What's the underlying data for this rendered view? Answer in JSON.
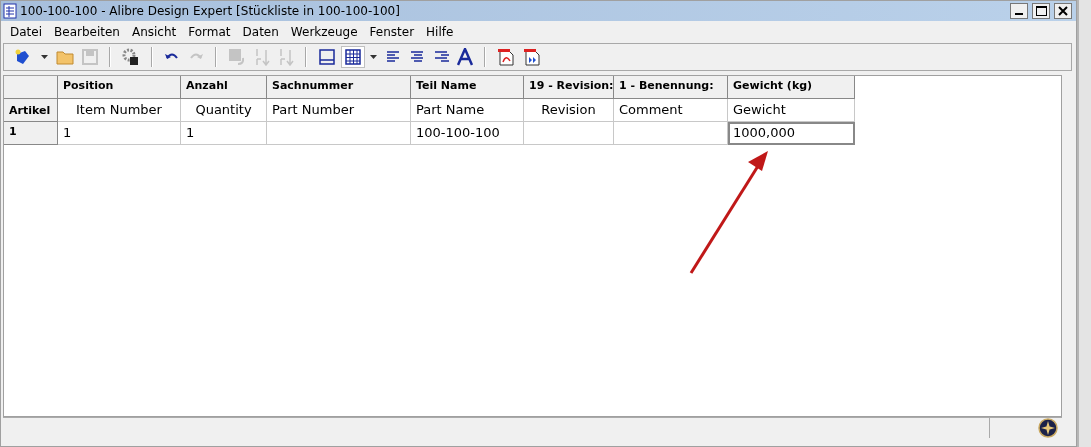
{
  "window": {
    "title": "100-100-100 - Alibre Design Expert [Stückliste in 100-100-100]"
  },
  "menu": [
    "Datei",
    "Bearbeiten",
    "Ansicht",
    "Format",
    "Daten",
    "Werkzeuge",
    "Fenster",
    "Hilfe"
  ],
  "toolbar": [
    [
      {
        "kind": "new",
        "disabled": false
      },
      {
        "kind": "dropdown",
        "disabled": false
      },
      {
        "kind": "open",
        "disabled": false
      },
      {
        "kind": "save",
        "disabled": true
      }
    ],
    [
      {
        "kind": "settings",
        "disabled": false
      }
    ],
    [
      {
        "kind": "undo",
        "disabled": false
      },
      {
        "kind": "redo",
        "disabled": true
      }
    ],
    [
      {
        "kind": "insert",
        "disabled": true
      },
      {
        "kind": "sort-asc",
        "disabled": true
      },
      {
        "kind": "sort-desc",
        "disabled": true
      }
    ],
    [
      {
        "kind": "border",
        "disabled": false
      },
      {
        "kind": "grid",
        "disabled": false
      },
      {
        "kind": "dropdown",
        "disabled": false
      },
      {
        "kind": "align-left",
        "disabled": false
      },
      {
        "kind": "align-center",
        "disabled": false
      },
      {
        "kind": "align-right",
        "disabled": false
      },
      {
        "kind": "font",
        "disabled": false
      }
    ],
    [
      {
        "kind": "pdf",
        "disabled": false
      },
      {
        "kind": "pdf-export",
        "disabled": false
      }
    ]
  ],
  "table": {
    "corner": "Artikel",
    "columns": [
      {
        "header": "Position",
        "caption": "Item Number"
      },
      {
        "header": "Anzahl",
        "caption": "Quantity"
      },
      {
        "header": "Sachnummer",
        "caption": "Part Number"
      },
      {
        "header": "Teil Name",
        "caption": "Part Name"
      },
      {
        "header": "19 - Revision:",
        "caption": "Revision"
      },
      {
        "header": "1 - Benennung:",
        "caption": "Comment"
      },
      {
        "header": "Gewicht (kg)",
        "caption": "Gewicht"
      }
    ],
    "rows": [
      {
        "label": "1",
        "cells": [
          {
            "text": "1",
            "selected": false
          },
          {
            "text": "1",
            "selected": false
          },
          {
            "selected": false
          },
          {
            "text": "100-100-100",
            "selected": false
          },
          {
            "selected": false
          },
          {
            "selected": false
          },
          {
            "text": "1000,000",
            "selected": true
          }
        ]
      }
    ]
  }
}
